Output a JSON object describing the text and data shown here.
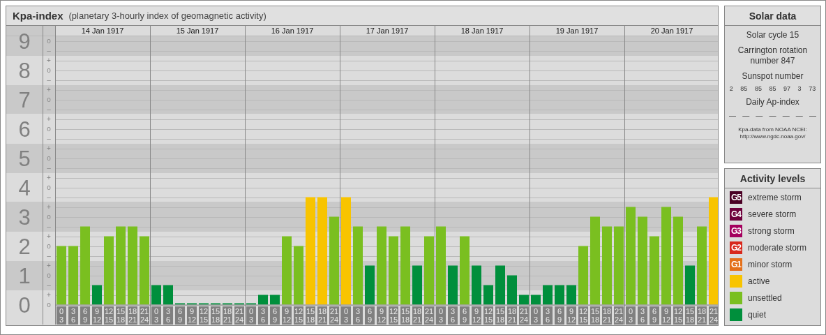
{
  "chart_panel": {
    "title": "Kpa-index",
    "subtitle": "(planetary 3-hourly index of geomagnetic activity)",
    "days": [
      "14 Jan 1917",
      "15 Jan 1917",
      "16 Jan 1917",
      "17 Jan 1917",
      "18 Jan 1917",
      "19 Jan 1917",
      "20 Jan 1917"
    ],
    "minor_tick_labels": [
      "o",
      "–",
      "+",
      "o",
      "–",
      "+",
      "o",
      "–",
      "+",
      "o",
      "–",
      "+",
      "o",
      "–",
      "+",
      "o",
      "–",
      "+",
      "o",
      "–",
      "+",
      "o",
      "–",
      "+",
      "o",
      "–",
      "+",
      "o"
    ],
    "chart_data": {
      "type": "bar",
      "grid": true,
      "ylim": [
        0,
        9.17
      ],
      "yticks": [
        {
          "value": 0,
          "label": "0"
        },
        {
          "value": 1,
          "label": "1"
        },
        {
          "value": 2,
          "label": "2"
        },
        {
          "value": 3,
          "label": "3"
        },
        {
          "value": 4,
          "label": "4"
        },
        {
          "value": 5,
          "label": "5"
        },
        {
          "value": 6,
          "label": "6"
        },
        {
          "value": 7,
          "label": "7"
        },
        {
          "value": 8,
          "label": "8"
        },
        {
          "value": 9,
          "label": "9"
        }
      ],
      "categories": [
        "0 3",
        "3 6",
        "6 9",
        "9 12",
        "12 15",
        "15 18",
        "18 21",
        "21 24",
        "0 3",
        "3 6",
        "6 9",
        "9 12",
        "12 15",
        "15 18",
        "18 21",
        "21 24",
        "0 3",
        "3 6",
        "6 9",
        "9 12",
        "12 15",
        "15 18",
        "18 21",
        "21 24",
        "0 3",
        "3 6",
        "6 9",
        "9 12",
        "12 15",
        "15 18",
        "18 21",
        "21 24",
        "0 3",
        "3 6",
        "6 9",
        "9 12",
        "12 15",
        "15 18",
        "18 21",
        "21 24",
        "0 3",
        "3 6",
        "6 9",
        "9 12",
        "12 15",
        "15 18",
        "18 21",
        "21 24",
        "0 3",
        "3 6",
        "6 9",
        "9 12",
        "12 15",
        "15 18",
        "18 21",
        "21 24"
      ],
      "series": [
        {
          "name": "active",
          "color": "#f8c400",
          "values": [
            null,
            null,
            null,
            null,
            null,
            null,
            null,
            null,
            null,
            null,
            null,
            null,
            null,
            null,
            null,
            null,
            null,
            null,
            null,
            null,
            null,
            3.67,
            3.67,
            null,
            3.67,
            null,
            null,
            null,
            null,
            null,
            null,
            null,
            null,
            null,
            null,
            null,
            null,
            null,
            null,
            null,
            null,
            null,
            null,
            null,
            null,
            null,
            null,
            null,
            null,
            null,
            null,
            null,
            null,
            null,
            null,
            3.67
          ]
        },
        {
          "name": "unsettled",
          "color": "#7abf20",
          "values": [
            2,
            2,
            2.67,
            null,
            2.33,
            2.67,
            2.67,
            2.33,
            null,
            null,
            null,
            null,
            null,
            null,
            null,
            null,
            null,
            null,
            null,
            2.33,
            2,
            null,
            null,
            3,
            null,
            2.67,
            null,
            2.67,
            2.33,
            2.67,
            null,
            2.33,
            2.67,
            null,
            2.33,
            null,
            null,
            null,
            null,
            null,
            null,
            null,
            null,
            null,
            2,
            3,
            2.67,
            2.67,
            3.33,
            3,
            2.33,
            3.33,
            3,
            null,
            2.67,
            null
          ]
        },
        {
          "name": "quiet",
          "color": "#008f3c",
          "values": [
            null,
            null,
            null,
            0.67,
            null,
            null,
            null,
            null,
            0.67,
            0.67,
            0,
            0,
            0,
            0,
            0,
            0,
            0,
            0.33,
            0.33,
            null,
            null,
            null,
            null,
            null,
            null,
            null,
            1.33,
            null,
            null,
            null,
            1.33,
            null,
            null,
            1.33,
            null,
            1.33,
            0.67,
            1.33,
            1,
            0.33,
            0.33,
            0.67,
            0.67,
            0.67,
            null,
            null,
            null,
            null,
            null,
            null,
            null,
            null,
            null,
            1.33,
            null,
            null
          ]
        }
      ]
    }
  },
  "solar_data": {
    "title": "Solar data",
    "solar_cycle": "Solar cycle 15",
    "carrington_rotation": "Carrington rotation number 847",
    "sunspot_label": "Sunspot number",
    "sunspot_numbers": [
      "2",
      "85",
      "85",
      "85",
      "97",
      "3",
      "73"
    ],
    "ap_label": "Daily Ap-index",
    "ap_values": [
      "—",
      "—",
      "—",
      "—",
      "—",
      "—",
      "—"
    ],
    "source": "Kpa-data from NOAA NCEI:",
    "source_url": "http://www.ngdc.noaa.gov/"
  },
  "activity_levels": {
    "title": "Activity levels",
    "items": [
      {
        "badge": "G5",
        "label": "extreme storm",
        "color": "#4a0024"
      },
      {
        "badge": "G4",
        "label": "severe storm",
        "color": "#6e003c"
      },
      {
        "badge": "G3",
        "label": "strong storm",
        "color": "#a4005e"
      },
      {
        "badge": "G2",
        "label": "moderate storm",
        "color": "#d8281c"
      },
      {
        "badge": "G1",
        "label": "minor storm",
        "color": "#e4701a"
      }
    ]
  }
}
